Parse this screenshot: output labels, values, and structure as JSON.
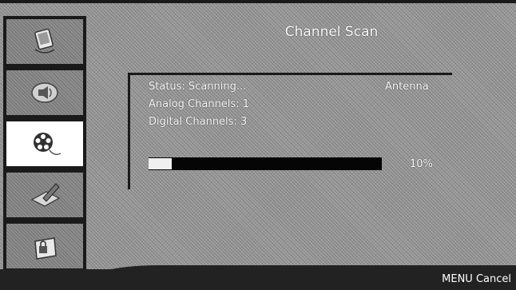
{
  "header": {
    "title": "Channel Scan"
  },
  "sidebar": {
    "items": [
      {
        "icon": "tv-screen-icon",
        "active": false
      },
      {
        "icon": "speaker-icon",
        "active": false
      },
      {
        "icon": "film-reel-icon",
        "active": true
      },
      {
        "icon": "pencil-setup-icon",
        "active": false
      },
      {
        "icon": "lock-icon",
        "active": false
      }
    ]
  },
  "scan": {
    "status": "Status: Scanning...",
    "source": "Antenna",
    "analog": "Analog Channels: 1",
    "digital": "Digital Channels: 3",
    "progress_label": "10%",
    "progress_value": 0.1
  },
  "footer": {
    "cancel_hint": "MENU Cancel"
  },
  "colors": {
    "background": "#9a9a9a",
    "active_tab": "#ffffff",
    "progress_track": "#050505",
    "progress_fill": "#efefef",
    "text": "#ffffff"
  }
}
